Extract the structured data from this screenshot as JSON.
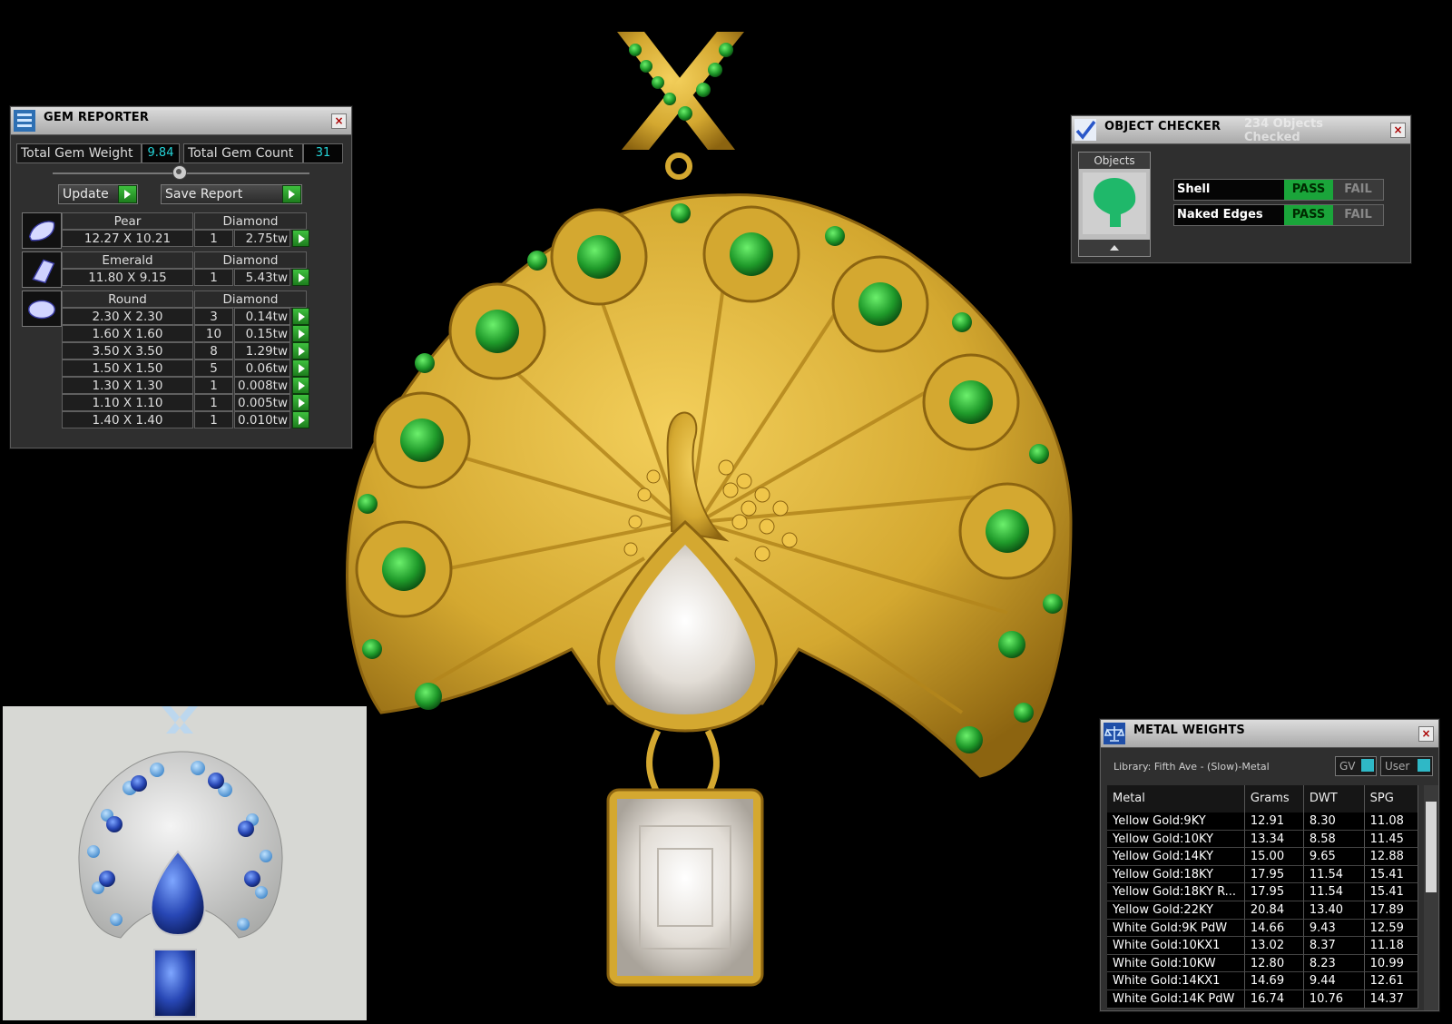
{
  "colors": {
    "gold": "#d4a830",
    "emerald": "#1f9a2a",
    "panel": "#2f2f2f",
    "pass": "#1aa53a",
    "cyan": "#25d4d8"
  },
  "gem_reporter": {
    "title": "GEM REPORTER",
    "total_weight_label": "Total Gem Weight",
    "total_weight": "9.84",
    "total_count_label": "Total Gem Count",
    "total_count": "31",
    "update_label": "Update",
    "save_label": "Save Report",
    "groups": [
      {
        "icon": "pear-gem-icon",
        "shape": "Pear",
        "type": "Diamond",
        "rows": [
          {
            "size": "12.27 X 10.21",
            "count": "1",
            "weight": "2.75tw"
          }
        ]
      },
      {
        "icon": "emerald-gem-icon",
        "shape": "Emerald",
        "type": "Diamond",
        "rows": [
          {
            "size": "11.80 X 9.15",
            "count": "1",
            "weight": "5.43tw"
          }
        ]
      },
      {
        "icon": "round-gem-icon",
        "shape": "Round",
        "type": "Diamond",
        "rows": [
          {
            "size": "2.30 X 2.30",
            "count": "3",
            "weight": "0.14tw"
          },
          {
            "size": "1.60 X 1.60",
            "count": "10",
            "weight": "0.15tw"
          },
          {
            "size": "3.50 X 3.50",
            "count": "8",
            "weight": "1.29tw"
          },
          {
            "size": "1.50 X 1.50",
            "count": "5",
            "weight": "0.06tw"
          },
          {
            "size": "1.30 X 1.30",
            "count": "1",
            "weight": "0.008tw"
          },
          {
            "size": "1.10 X 1.10",
            "count": "1",
            "weight": "0.005tw"
          },
          {
            "size": "1.40 X 1.40",
            "count": "1",
            "weight": "0.010tw"
          }
        ]
      }
    ]
  },
  "object_checker": {
    "title": "OBJECT CHECKER",
    "status": "234  Objects Checked",
    "objects_label": "Objects",
    "checks": [
      {
        "name": "Shell",
        "pass": "PASS",
        "fail": "FAIL"
      },
      {
        "name": "Naked Edges",
        "pass": "PASS",
        "fail": "FAIL"
      }
    ]
  },
  "metal_weights": {
    "title": "METAL WEIGHTS",
    "library": "Library: Fifth Ave - (Slow)-Metal",
    "toggle_gv": "GV",
    "toggle_user": "User",
    "headers": [
      "Metal",
      "Grams",
      "DWT",
      "SPG"
    ],
    "rows": [
      [
        "Yellow Gold:9KY",
        "12.91",
        "8.30",
        "11.08"
      ],
      [
        "Yellow Gold:10KY",
        "13.34",
        "8.58",
        "11.45"
      ],
      [
        "Yellow Gold:14KY",
        "15.00",
        "9.65",
        "12.88"
      ],
      [
        "Yellow Gold:18KY",
        "17.95",
        "11.54",
        "15.41"
      ],
      [
        "Yellow Gold:18KY R...",
        "17.95",
        "11.54",
        "15.41"
      ],
      [
        "Yellow Gold:22KY",
        "20.84",
        "13.40",
        "17.89"
      ],
      [
        "White Gold:9K PdW",
        "14.66",
        "9.43",
        "12.59"
      ],
      [
        "White Gold:10KX1",
        "13.02",
        "8.37",
        "11.18"
      ],
      [
        "White Gold:10KW",
        "12.80",
        "8.23",
        "10.99"
      ],
      [
        "White Gold:14KX1",
        "14.69",
        "9.44",
        "12.61"
      ],
      [
        "White Gold:14K PdW",
        "16.74",
        "10.76",
        "14.37"
      ]
    ]
  }
}
